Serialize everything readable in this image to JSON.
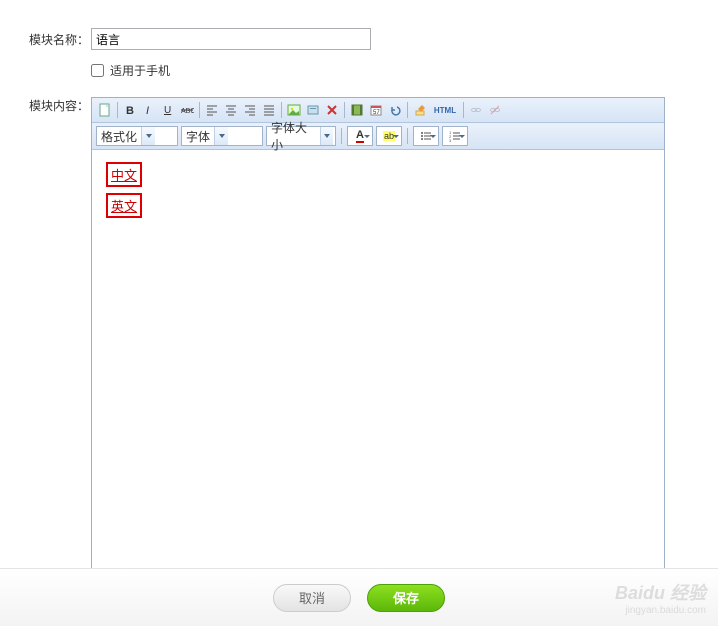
{
  "form": {
    "module_name_label": "模块名称：",
    "module_name_value": "语言",
    "mobile_checkbox_label": "适用于手机",
    "module_content_label": "模块内容："
  },
  "editor": {
    "format_label": "格式化",
    "font_label": "字体",
    "fontsize_label": "字体大小",
    "html_label": "HTML",
    "content_links": [
      "中文",
      "英文"
    ],
    "fontcolor_glyph": "A",
    "highlight_glyph": "ab"
  },
  "buttons": {
    "cancel": "取消",
    "save": "保存"
  },
  "watermark": {
    "brand": "Baidu 经验",
    "url": "jingyan.baidu.com"
  }
}
